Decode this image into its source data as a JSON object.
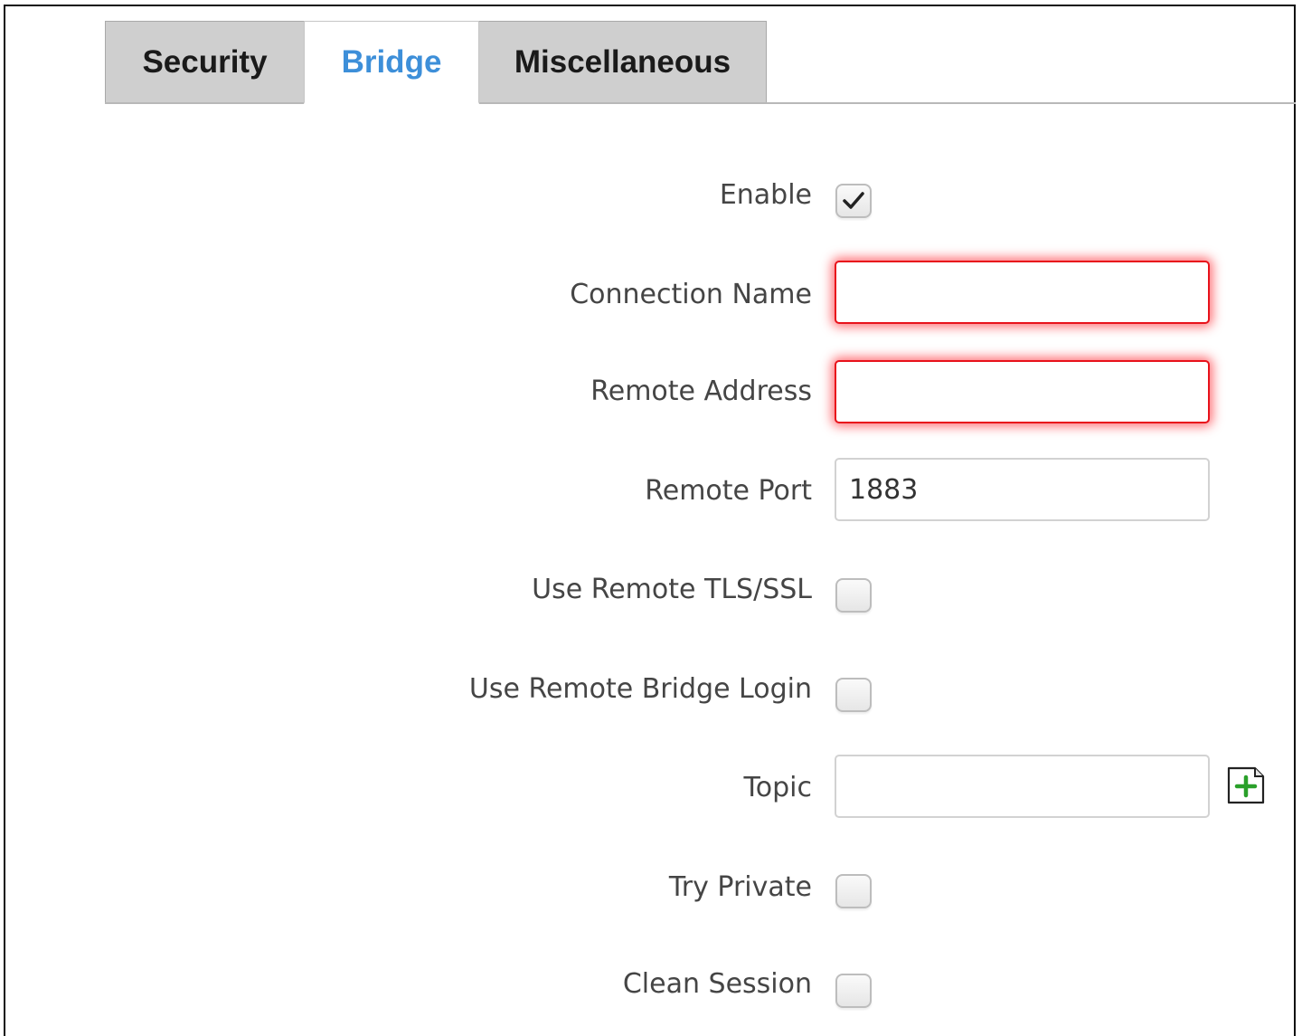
{
  "tabs": [
    {
      "label": "Security",
      "active": false
    },
    {
      "label": "Bridge",
      "active": true
    },
    {
      "label": "Miscellaneous",
      "active": false
    }
  ],
  "form": {
    "enable": {
      "label": "Enable",
      "checked": true
    },
    "connection_name": {
      "label": "Connection Name",
      "value": "",
      "state": "error"
    },
    "remote_address": {
      "label": "Remote Address",
      "value": "",
      "state": "error"
    },
    "remote_port": {
      "label": "Remote Port",
      "value": "1883"
    },
    "use_remote_tls": {
      "label": "Use Remote TLS/SSL",
      "checked": false
    },
    "use_remote_login": {
      "label": "Use Remote Bridge Login",
      "checked": false
    },
    "topic": {
      "label": "Topic",
      "value": "",
      "add_icon": "add-file-icon"
    },
    "try_private": {
      "label": "Try Private",
      "checked": false
    },
    "clean_session": {
      "label": "Clean Session",
      "checked": false
    }
  },
  "colors": {
    "active_tab": "#3d8fd9",
    "inactive_tab_bg": "#cfcfcf",
    "error_border": "#e8121b",
    "add_icon_green": "#2aa02a"
  }
}
